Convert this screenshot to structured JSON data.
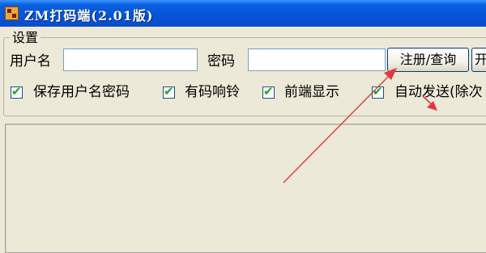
{
  "window": {
    "title": "ZM打码端(2.01版)",
    "icon": "app-icon"
  },
  "settings": {
    "group_label": "设置",
    "username_label": "用户名",
    "username_value": "",
    "password_label": "密码",
    "password_value": "",
    "register_button": "注册/查询",
    "start_button": "开"
  },
  "checkboxes": [
    {
      "label": "保存用户名密码",
      "checked": true
    },
    {
      "label": "有码响铃",
      "checked": true
    },
    {
      "label": "前端显示",
      "checked": true
    },
    {
      "label": "自动发送(除次",
      "checked": true
    }
  ],
  "annotation": {
    "color": "#e0393e",
    "icons": [
      "annotation-arrow-icon",
      "annotation-arrow-icon"
    ]
  }
}
